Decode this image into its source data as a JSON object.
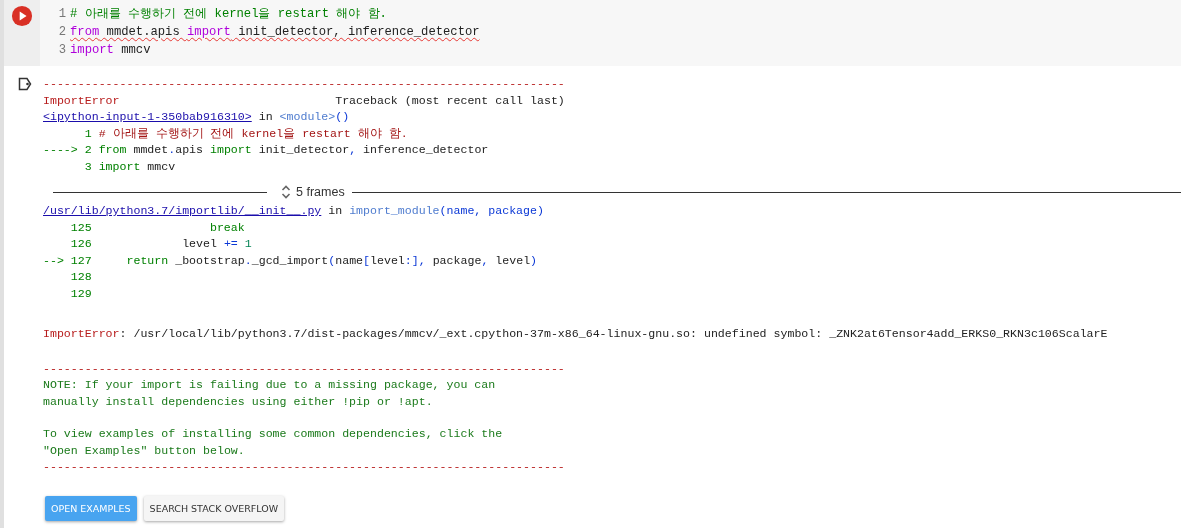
{
  "code_cell": {
    "lines": [
      {
        "number": "1",
        "misspelled": false,
        "tokens": [
          {
            "text": "# 아래를 수행하기 전에 kernel을 restart 해야 함.",
            "kind": "comment"
          }
        ]
      },
      {
        "number": "2",
        "misspelled": true,
        "tokens": [
          {
            "text": "from",
            "kind": "keyword"
          },
          {
            "text": " mmdet.apis ",
            "kind": "plain"
          },
          {
            "text": "import",
            "kind": "keyword"
          },
          {
            "text": " init_detector, inference_detector",
            "kind": "plain"
          }
        ]
      },
      {
        "number": "3",
        "misspelled": false,
        "tokens": [
          {
            "text": "import",
            "kind": "keyword"
          },
          {
            "text": " mmcv",
            "kind": "plain"
          }
        ]
      }
    ]
  },
  "output": {
    "rule": "---------------------------------------------------------------------------",
    "header": {
      "error_name": "ImportError",
      "traceback": "Traceback (most recent call last)"
    },
    "frames_before": [
      {
        "file": "<ipython-input-1-350bab916310>",
        "in": "in",
        "func": "<module>",
        "args": "()",
        "lines": [
          {
            "number": "1",
            "tokens": [
              {
                "text": "# 아래를 수행하기 전에 kernel을 restart 해야 함.",
                "kind": "error_comment"
              }
            ]
          },
          {
            "marker": "---->",
            "number": "2",
            "tokens": [
              {
                "text": "from",
                "kind": "tb_keyword"
              },
              {
                "text": " mmdet",
                "kind": "plain"
              },
              {
                "text": ".",
                "kind": "punct"
              },
              {
                "text": "apis ",
                "kind": "plain"
              },
              {
                "text": "import",
                "kind": "tb_keyword"
              },
              {
                "text": " init_detector",
                "kind": "plain"
              },
              {
                "text": ",",
                "kind": "punct"
              },
              {
                "text": " inference_detector",
                "kind": "plain"
              }
            ]
          },
          {
            "number": "3",
            "tokens": [
              {
                "text": "import",
                "kind": "tb_keyword"
              },
              {
                "text": " mmcv",
                "kind": "plain"
              }
            ]
          }
        ]
      }
    ],
    "collapsed": {
      "label": "5 frames"
    },
    "frames_after": [
      {
        "file": "/usr/lib/python3.7/importlib/__init__.py",
        "in": "in",
        "func": "import_module",
        "args": "(name, package)",
        "lines": [
          {
            "number": "125",
            "tokens": [
              {
                "text": "                break",
                "kind": "tb_keyword"
              }
            ]
          },
          {
            "number": "126",
            "tokens": [
              {
                "text": "            level ",
                "kind": "plain"
              },
              {
                "text": "+=",
                "kind": "punct"
              },
              {
                "text": " 1",
                "kind": "number"
              }
            ]
          },
          {
            "marker": "-->",
            "number": "127",
            "tokens": [
              {
                "text": "    return",
                "kind": "tb_keyword"
              },
              {
                "text": " _bootstrap",
                "kind": "plain"
              },
              {
                "text": ".",
                "kind": "punct"
              },
              {
                "text": "_gcd_import",
                "kind": "plain"
              },
              {
                "text": "(",
                "kind": "punct"
              },
              {
                "text": "name",
                "kind": "plain"
              },
              {
                "text": "[",
                "kind": "punct"
              },
              {
                "text": "level",
                "kind": "plain"
              },
              {
                "text": ":],",
                "kind": "punct"
              },
              {
                "text": " package",
                "kind": "plain"
              },
              {
                "text": ",",
                "kind": "punct"
              },
              {
                "text": " level",
                "kind": "plain"
              },
              {
                "text": ")",
                "kind": "punct"
              }
            ]
          },
          {
            "number": "128"
          },
          {
            "number": "129"
          }
        ]
      }
    ],
    "error": {
      "name": "ImportError",
      "message": ": /usr/local/lib/python3.7/dist-packages/mmcv/_ext.cpython-37m-x86_64-linux-gnu.so: undefined symbol: _ZNK2at6Tensor4add_ERKS0_RKN3c106ScalarE"
    },
    "note": {
      "rule_top": "---------------------------------------------------------------------------",
      "paragraphs": [
        [
          "NOTE: If your import is failing due to a missing package, you can",
          "manually install dependencies using either !pip or !apt."
        ],
        [
          "To view examples of installing some common dependencies, click the",
          "\"Open Examples\" button below."
        ]
      ],
      "rule_bottom": "---------------------------------------------------------------------------"
    },
    "buttons": [
      {
        "label": "OPEN EXAMPLES",
        "kind": "primary"
      },
      {
        "label": "SEARCH STACK OVERFLOW",
        "kind": "secondary"
      }
    ]
  }
}
